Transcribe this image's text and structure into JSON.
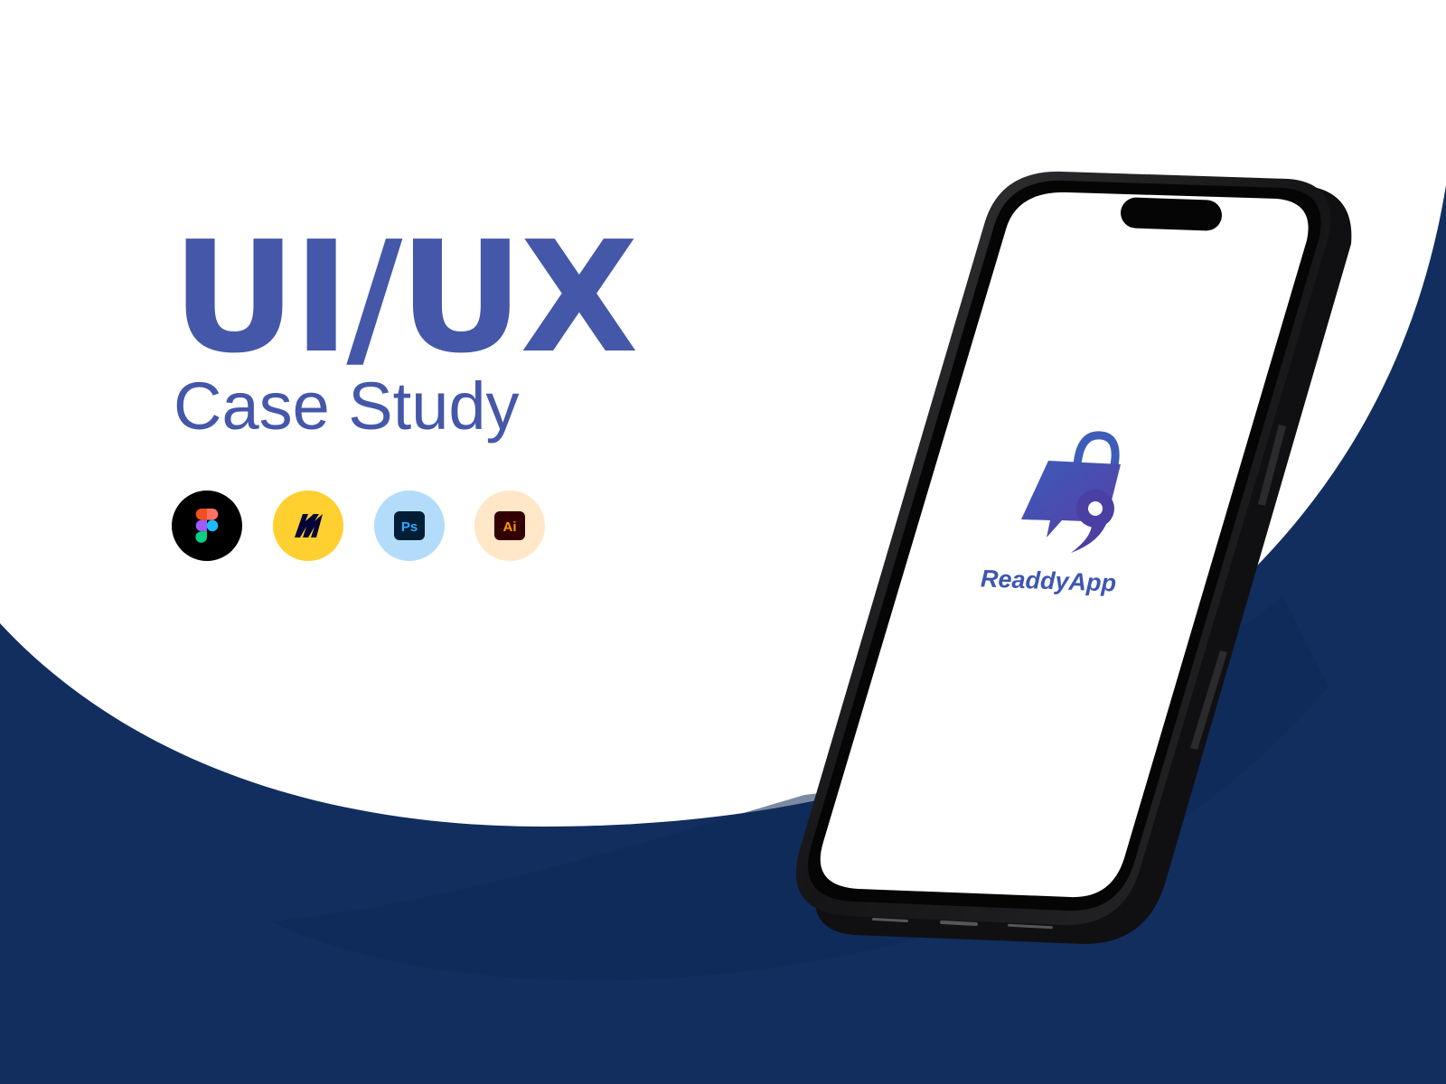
{
  "hero": {
    "title": "UI/UX",
    "subtitle": "Case Study"
  },
  "tools": [
    {
      "icon": "figma-icon",
      "bg": "#000000"
    },
    {
      "icon": "miro-icon",
      "bg": "#ffd02f"
    },
    {
      "icon": "photoshop-icon",
      "label": "Ps",
      "bg": "#b3dcfb"
    },
    {
      "icon": "illustrator-icon",
      "label": "Ai",
      "bg": "#ffe7c7"
    }
  ],
  "phone": {
    "app_name": "ReaddyApp",
    "logo_icon": "shopping-bag-icon"
  },
  "colors": {
    "brand": "#4457a9",
    "navy": "#112e5f",
    "phone_frame": "#1b1b1d"
  }
}
